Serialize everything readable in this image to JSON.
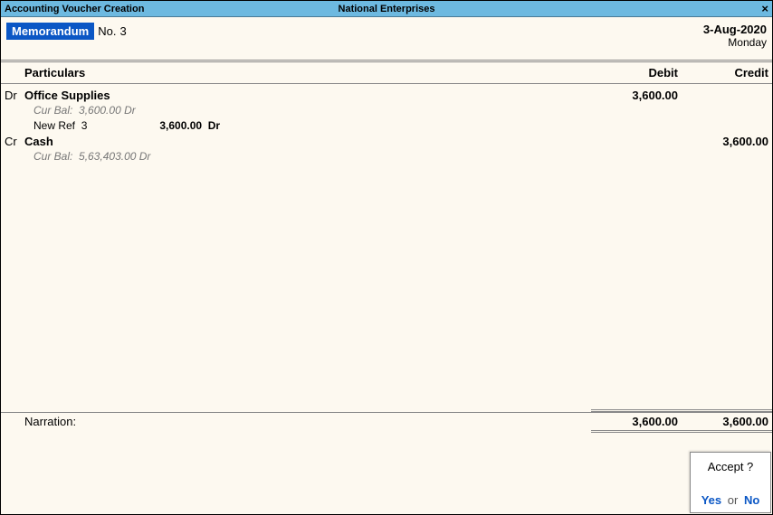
{
  "title_bar": {
    "left": "Accounting Voucher Creation",
    "center": "National Enterprises",
    "close": "×"
  },
  "voucher": {
    "type": "Memorandum",
    "no_label": "No.",
    "no_value": "3",
    "date": "3-Aug-2020",
    "day": "Monday"
  },
  "columns": {
    "particulars": "Particulars",
    "debit": "Debit",
    "credit": "Credit"
  },
  "entries": [
    {
      "drcr": "Dr",
      "ledger": "Office Supplies",
      "cur_bal_label": "Cur Bal:",
      "cur_bal_value": "3,600.00 Dr",
      "ref_label": "New Ref",
      "ref_value": "3",
      "ref_amount": "3,600.00",
      "ref_drcr": "Dr",
      "debit": "3,600.00",
      "credit": ""
    },
    {
      "drcr": "Cr",
      "ledger": "Cash",
      "cur_bal_label": "Cur Bal:",
      "cur_bal_value": "5,63,403.00 Dr",
      "debit": "",
      "credit": "3,600.00"
    }
  ],
  "totals": {
    "debit": "3,600.00",
    "credit": "3,600.00"
  },
  "narration": {
    "label": "Narration:"
  },
  "dialog": {
    "question": "Accept ?",
    "yes": "Yes",
    "or": "or",
    "no": "No"
  }
}
